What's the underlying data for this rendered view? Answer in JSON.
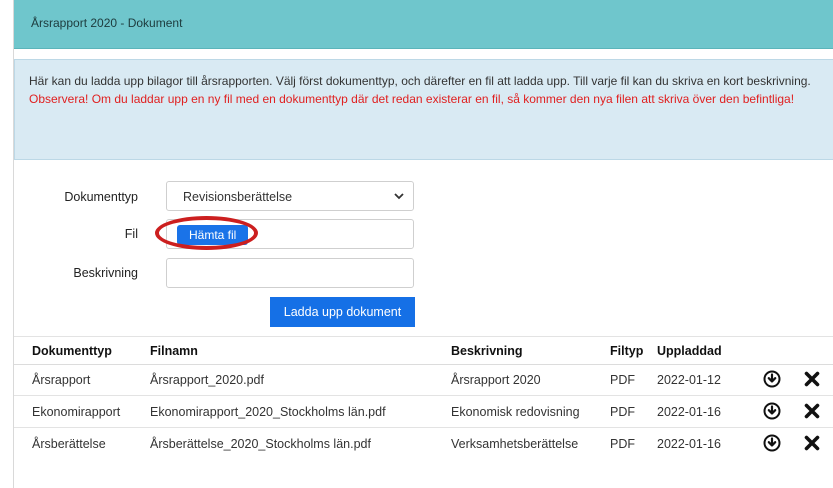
{
  "header": {
    "title": "Årsrapport 2020 - Dokument"
  },
  "info": {
    "text": "Här kan du ladda upp bilagor till årsrapporten. Välj först dokumenttyp, och därefter en fil att ladda upp. Till varje fil kan du skriva en kort beskrivning.",
    "warning": "Observera! Om du laddar upp en ny fil med en dokumenttyp där det redan existerar en fil, så kommer den nya filen att skriva över den befintliga!"
  },
  "form": {
    "doctype_label": "Dokumenttyp",
    "doctype_value": "Revisionsberättelse",
    "file_label": "Fil",
    "file_button": "Hämta fil",
    "description_label": "Beskrivning",
    "description_value": "",
    "upload_button": "Ladda upp dokument"
  },
  "table": {
    "headers": [
      "Dokumenttyp",
      "Filnamn",
      "Beskrivning",
      "Filtyp",
      "Uppladdad"
    ],
    "rows": [
      [
        "Årsrapport",
        "Årsrapport_2020.pdf",
        "Årsrapport 2020",
        "PDF",
        "2022-01-12"
      ],
      [
        "Ekonomirapport",
        "Ekonomirapport_2020_Stockholms län.pdf",
        "Ekonomisk redovisning",
        "PDF",
        "2022-01-16"
      ],
      [
        "Årsberättelse",
        "Årsberättelse_2020_Stockholms län.pdf",
        "Verksamhetsberättelse",
        "PDF",
        "2022-01-16"
      ]
    ]
  },
  "icons": {
    "row_actions": [
      "download-circle-icon",
      "delete-x-icon"
    ]
  },
  "colors": {
    "header_bg": "#6fc6cc",
    "info_bg": "#d9eaf3",
    "warning": "#e02020",
    "button": "#1a73e8",
    "annotation": "#cc1f1f"
  }
}
